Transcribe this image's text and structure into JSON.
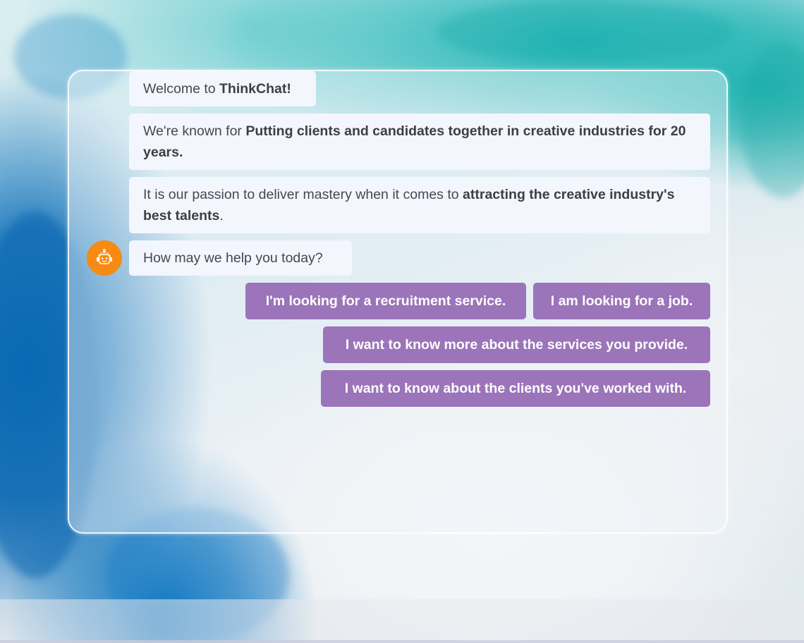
{
  "chat": {
    "messages": [
      {
        "prefix": "Welcome to ",
        "bold": "ThinkChat!",
        "suffix": ""
      },
      {
        "prefix": "We're known for ",
        "bold": "Putting clients and candidates together in creative industries for 20 years.",
        "suffix": ""
      },
      {
        "prefix": "It is our passion to deliver mastery when it comes to ",
        "bold": "attracting the creative industry's best talents",
        "suffix": "."
      },
      {
        "prefix": "How may we help you today?",
        "bold": "",
        "suffix": ""
      }
    ],
    "bot_avatar_icon": "robot-icon",
    "bot_avatar_color": "#f68a12",
    "choices": [
      {
        "label": "I'm looking for a recruitment service."
      },
      {
        "label": "I am looking for a job."
      },
      {
        "label": "I want to know more about the services you provide."
      },
      {
        "label": "I want to know about the clients you've worked with."
      }
    ],
    "choice_color": "#9b74b9",
    "bubble_color": "#f4f6fd"
  }
}
